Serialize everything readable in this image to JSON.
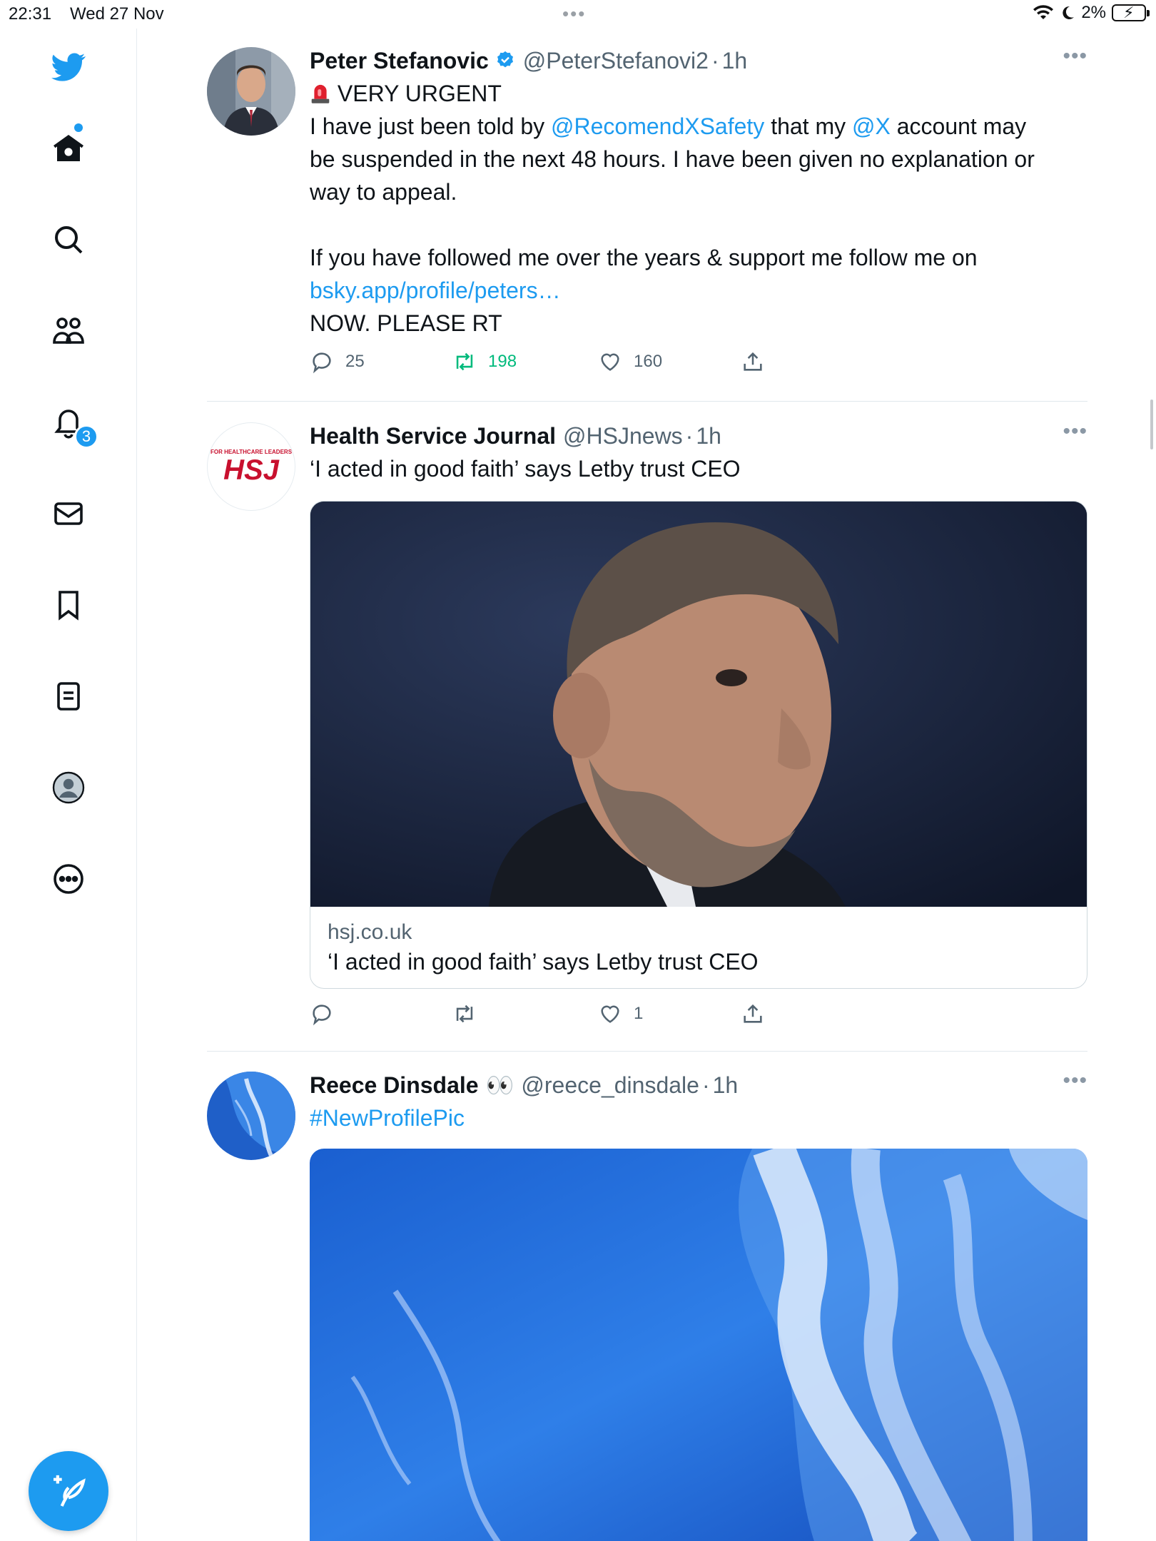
{
  "status_bar": {
    "time": "22:31",
    "date": "Wed 27 Nov",
    "battery": "2%"
  },
  "sidebar": {
    "notifications_badge": "3"
  },
  "tweets": [
    {
      "name": "Peter Stefanovic",
      "handle": "@PeterStefanovi2",
      "time": "1h",
      "verified": true,
      "line1": "VERY URGENT",
      "line2_pre": "I have just been told by ",
      "line2_link1": "@RecomendXSafety",
      "line2_mid": " that my ",
      "line2_link2": "@X",
      "line2_post": " account may",
      "line3": "be suspended in the next 48 hours. I have been given no explanation or",
      "line4": "way to appeal.",
      "line5": "If you have followed me over the years & support me follow me on",
      "link": "bsky.app/profile/peters…",
      "line6": "NOW. PLEASE RT",
      "replies": "25",
      "retweets": "198",
      "likes": "160"
    },
    {
      "name": "Health Service Journal",
      "handle": "@HSJnews",
      "time": "1h",
      "text": "‘I acted in good faith’ says Letby trust CEO",
      "card_domain": "hsj.co.uk",
      "card_title": "‘I acted in good faith’ says Letby trust CEO",
      "logo_text": "HSJ",
      "logo_tagline": "FOR HEALTHCARE LEADERS",
      "likes": "1"
    },
    {
      "name": "Reece Dinsdale",
      "emoji": "👀",
      "handle": "@reece_dinsdale",
      "time": "1h",
      "hashtag": "#NewProfilePic"
    }
  ],
  "colors": {
    "accent": "#1d9bf0",
    "retweet_active": "#00ba7c",
    "secondary_text": "#536471"
  },
  "icons": [
    "twitter-logo-icon",
    "home-icon",
    "search-icon",
    "communities-icon",
    "notifications-icon",
    "messages-icon",
    "bookmarks-icon",
    "lists-icon",
    "profile-icon",
    "more-icon",
    "compose-icon",
    "reply-icon",
    "retweet-icon",
    "like-icon",
    "share-icon",
    "verified-icon",
    "siren-icon"
  ]
}
